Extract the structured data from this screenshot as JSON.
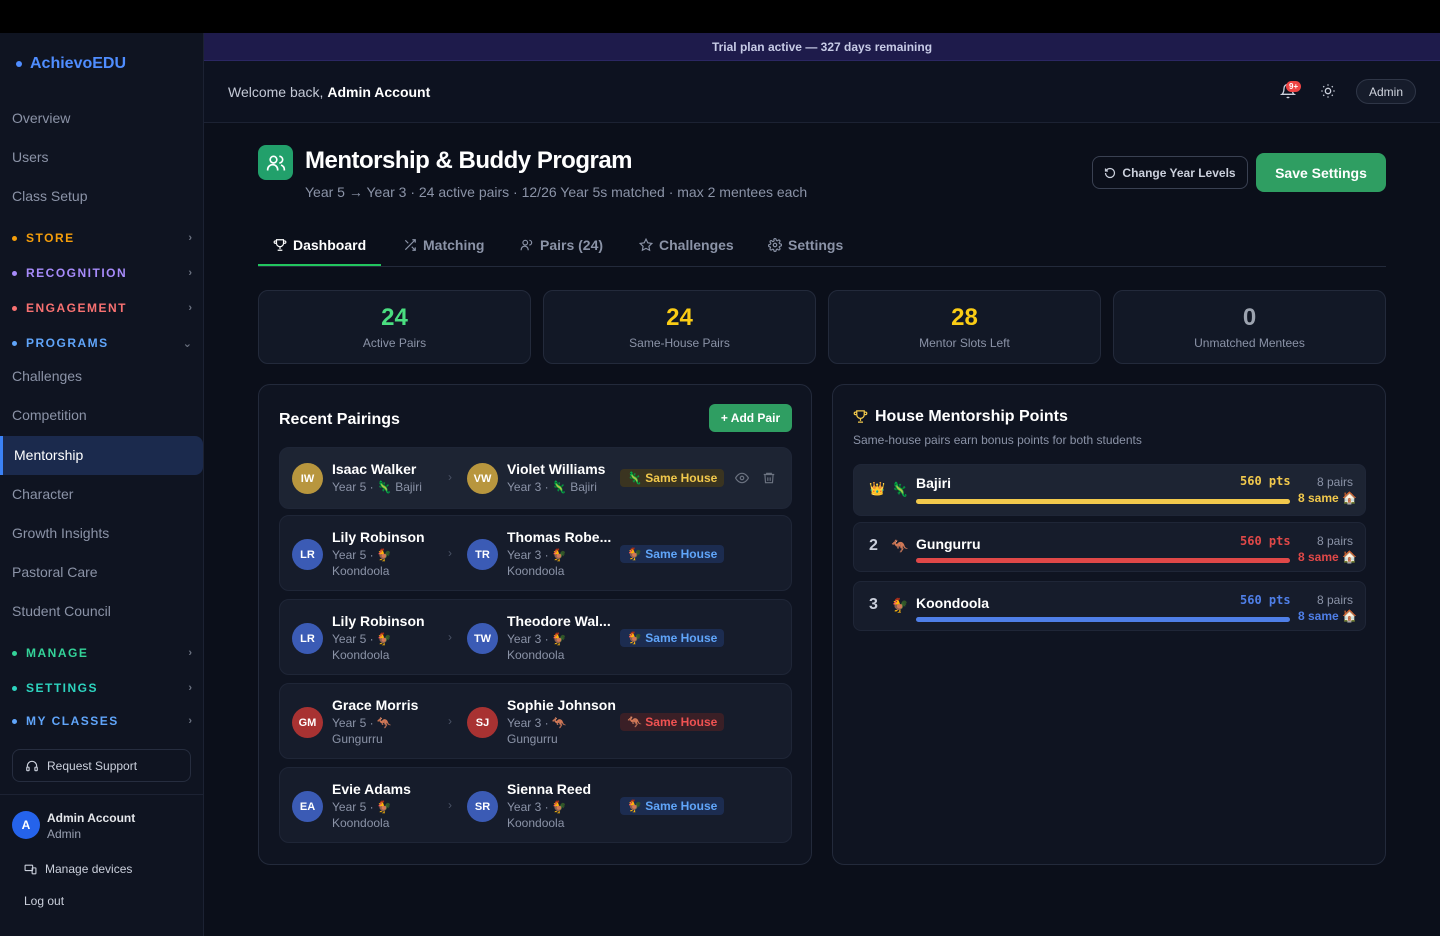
{
  "brand": "AchievoEDU",
  "nav": {
    "overview": "Overview",
    "users": "Users",
    "class_setup": "Class Setup",
    "store": "STORE",
    "recognition": "RECOGNITION",
    "engagement": "ENGAGEMENT",
    "programs": "PROGRAMS",
    "challenges": "Challenges",
    "competition": "Competition",
    "mentorship": "Mentorship",
    "character": "Character",
    "growth_insights": "Growth Insights",
    "pastoral_care": "Pastoral Care",
    "student_council": "Student Council",
    "manage": "MANAGE",
    "settings": "SETTINGS",
    "my_classes": "MY CLASSES",
    "request_support": "Request Support"
  },
  "colors": {
    "store": "#f59e0b",
    "recognition": "#a78bfa",
    "engagement": "#f87171",
    "programs": "#60a5fa",
    "manage": "#34d399",
    "settings": "#2dd4bf",
    "my_classes": "#60a5fa",
    "accent_green": "#2f9e62",
    "bajiri": "#f2c94c",
    "gungurru": "#e04848",
    "koondoola": "#4f7fe8"
  },
  "account": {
    "initial": "A",
    "name": "Admin Account",
    "role": "Admin",
    "manage_devices": "Manage devices",
    "logout": "Log out"
  },
  "trial_banner": "Trial plan active — 327 days remaining",
  "header": {
    "welcome_prefix": "Welcome back,",
    "welcome_name": "Admin Account",
    "notif_badge": "9+",
    "admin_label": "Admin"
  },
  "program": {
    "title": "Mentorship & Buddy Program",
    "subtitle": "Year 5 → Year 3 · 24 active pairs · 12/26 Year 5s matched · max 2 mentees each",
    "change_levels": "Change Year Levels",
    "save": "Save Settings"
  },
  "tabs": [
    "Dashboard",
    "Matching",
    "Pairs (24)",
    "Challenges",
    "Settings"
  ],
  "stats": [
    {
      "value": "24",
      "label": "Active Pairs",
      "color": "#4ade80"
    },
    {
      "value": "24",
      "label": "Same-House Pairs",
      "color": "#facc15"
    },
    {
      "value": "28",
      "label": "Mentor Slots Left",
      "color": "#facc15"
    },
    {
      "value": "0",
      "label": "Unmatched Mentees",
      "color": "#9ca3af"
    }
  ],
  "recent": {
    "title": "Recent Pairings",
    "add_pair": "+ Add Pair",
    "pairs": [
      {
        "m_init": "IW",
        "m_name": "Isaac Walker",
        "m_meta": "Year 5 · 🦎 Bajiri",
        "m_meta2": "",
        "m_color": "#b8963e",
        "e_init": "VW",
        "e_name": "Violet Williams",
        "e_meta": "Year 3 · 🦎 Bajiri",
        "e_meta2": "",
        "e_color": "#b8963e",
        "badge": "🦎 Same House",
        "badge_style": "gold"
      },
      {
        "m_init": "LR",
        "m_name": "Lily Robinson",
        "m_meta": "Year 5 · 🐓",
        "m_meta2": "Koondoola",
        "m_color": "#3b5bb5",
        "e_init": "TR",
        "e_name": "Thomas Robe...",
        "e_meta": "Year 3 · 🐓",
        "e_meta2": "Koondoola",
        "e_color": "#3b5bb5",
        "badge": "🐓 Same House",
        "badge_style": "blue"
      },
      {
        "m_init": "LR",
        "m_name": "Lily Robinson",
        "m_meta": "Year 5 · 🐓",
        "m_meta2": "Koondoola",
        "m_color": "#3b5bb5",
        "e_init": "TW",
        "e_name": "Theodore Wal...",
        "e_meta": "Year 3 · 🐓",
        "e_meta2": "Koondoola",
        "e_color": "#3b5bb5",
        "badge": "🐓 Same House",
        "badge_style": "blue"
      },
      {
        "m_init": "GM",
        "m_name": "Grace Morris",
        "m_meta": "Year 5 · 🦘",
        "m_meta2": "Gungurru",
        "m_color": "#a83232",
        "e_init": "SJ",
        "e_name": "Sophie Johnson",
        "e_meta": "Year 3 · 🦘",
        "e_meta2": "Gungurru",
        "e_color": "#a83232",
        "badge": "🦘 Same House",
        "badge_style": "red"
      },
      {
        "m_init": "EA",
        "m_name": "Evie Adams",
        "m_meta": "Year 5 · 🐓",
        "m_meta2": "Koondoola",
        "m_color": "#3b5bb5",
        "e_init": "SR",
        "e_name": "Sienna Reed",
        "e_meta": "Year 3 · 🐓",
        "e_meta2": "Koondoola",
        "e_color": "#3b5bb5",
        "badge": "🐓 Same House",
        "badge_style": "blue"
      }
    ]
  },
  "houses": {
    "title": "House Mentorship Points",
    "subtitle": "Same-house pairs earn bonus points for both students",
    "rows": [
      {
        "rank": "👑",
        "icon": "🦎",
        "name": "Bajiri",
        "pts": "560 pts",
        "pairs": "8 pairs",
        "same": "8 same 🏠",
        "color": "#f2c94c",
        "fill": 1.0
      },
      {
        "rank": "2",
        "icon": "🦘",
        "name": "Gungurru",
        "pts": "560 pts",
        "pairs": "8 pairs",
        "same": "8 same 🏠",
        "color": "#e04848",
        "fill": 1.0
      },
      {
        "rank": "3",
        "icon": "🐓",
        "name": "Koondoola",
        "pts": "560 pts",
        "pairs": "8 pairs",
        "same": "8 same 🏠",
        "color": "#4f7fe8",
        "fill": 1.0
      }
    ]
  }
}
